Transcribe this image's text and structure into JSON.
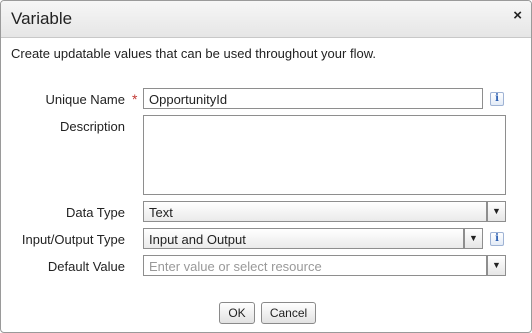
{
  "dialog": {
    "title": "Variable",
    "close_glyph": "×",
    "intro": "Create updatable values that can be used throughout your flow."
  },
  "form": {
    "unique_name": {
      "label": "Unique Name",
      "required_marker": "*",
      "value": "OpportunityId",
      "info_icon": "info-icon"
    },
    "description": {
      "label": "Description",
      "value": ""
    },
    "data_type": {
      "label": "Data Type",
      "selected": "Text",
      "arrow": "▼"
    },
    "input_output_type": {
      "label": "Input/Output Type",
      "selected": "Input and Output",
      "arrow": "▼",
      "info_icon": "info-icon"
    },
    "default_value": {
      "label": "Default Value",
      "placeholder": "Enter value or select resource",
      "arrow": "▼"
    }
  },
  "buttons": {
    "ok": "OK",
    "cancel": "Cancel"
  },
  "colors": {
    "required": "#c23934",
    "info": "#2a5db0"
  }
}
